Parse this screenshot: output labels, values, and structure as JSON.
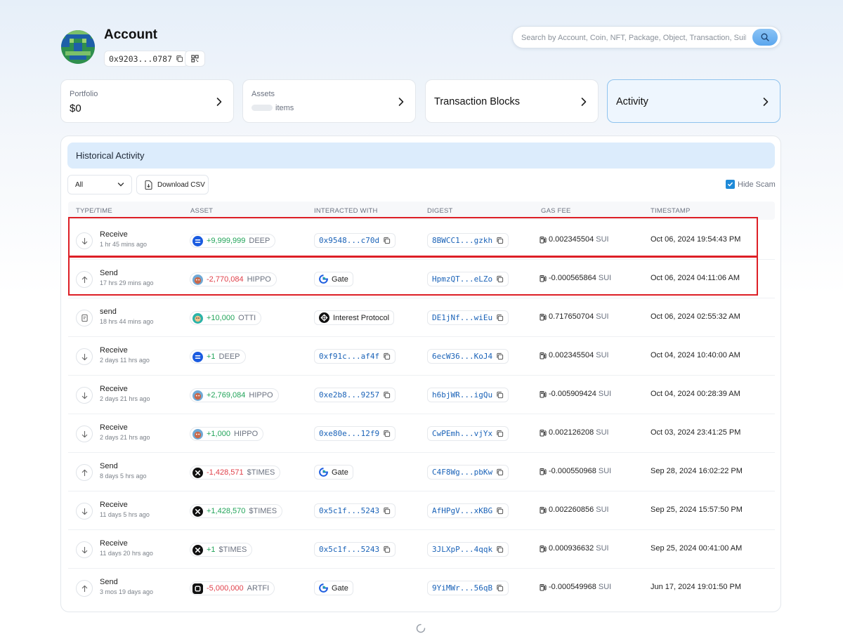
{
  "header": {
    "title": "Account",
    "address": "0x9203...0787"
  },
  "search": {
    "placeholder": "Search by Account, Coin, NFT, Package, Object, Transaction, SuiNS"
  },
  "cards": {
    "portfolio_label": "Portfolio",
    "portfolio_value": "$0",
    "assets_label": "Assets",
    "assets_suffix": "items",
    "tx_blocks_label": "Transaction Blocks",
    "activity_label": "Activity"
  },
  "panel": {
    "title": "Historical Activity",
    "filter_value": "All",
    "download_label": "Download CSV",
    "hide_scam_label": "Hide Scam",
    "hide_scam_checked": true
  },
  "table": {
    "headers": [
      "TYPE/TIME",
      "ASSET",
      "INTERACTED WITH",
      "DIGEST",
      "GAS FEE",
      "TIMESTAMP"
    ],
    "rows": [
      {
        "type": "Receive",
        "age": "1 hr 45 mins ago",
        "dir": "down",
        "amount": "+9,999,999",
        "symbol": "DEEP",
        "coin": "deep",
        "with": "0x9548...c70d",
        "with_kind": "address",
        "digest": "8BWCC1...gzkh",
        "gas": "0.002345504",
        "gas_unit": "SUI",
        "timestamp": "Oct 06, 2024 19:54:43 PM"
      },
      {
        "type": "Send",
        "age": "17 hrs 29 mins ago",
        "dir": "up",
        "amount": "-2,770,084",
        "symbol": "HIPPO",
        "coin": "hippo",
        "with": "Gate",
        "with_kind": "gate",
        "digest": "HpmzQT...eLZo",
        "gas": "-0.000565864",
        "gas_unit": "SUI",
        "timestamp": "Oct 06, 2024 04:11:06 AM"
      },
      {
        "type": "send",
        "age": "18 hrs 44 mins ago",
        "dir": "doc",
        "amount": "+10,000",
        "symbol": "OTTI",
        "coin": "otti",
        "with": "Interest Protocol",
        "with_kind": "interest",
        "digest": "DE1jNf...wiEu",
        "gas": "0.717650704",
        "gas_unit": "SUI",
        "timestamp": "Oct 06, 2024 02:55:32 AM"
      },
      {
        "type": "Receive",
        "age": "2 days 11 hrs ago",
        "dir": "down",
        "amount": "+1",
        "symbol": "DEEP",
        "coin": "deep",
        "with": "0xf91c...af4f",
        "with_kind": "address",
        "digest": "6ecW36...KoJ4",
        "gas": "0.002345504",
        "gas_unit": "SUI",
        "timestamp": "Oct 04, 2024 10:40:00 AM"
      },
      {
        "type": "Receive",
        "age": "2 days 21 hrs ago",
        "dir": "down",
        "amount": "+2,769,084",
        "symbol": "HIPPO",
        "coin": "hippo",
        "with": "0xe2b8...9257",
        "with_kind": "address",
        "digest": "h6bjWR...igQu",
        "gas": "-0.005909424",
        "gas_unit": "SUI",
        "timestamp": "Oct 04, 2024 00:28:39 AM"
      },
      {
        "type": "Receive",
        "age": "2 days 21 hrs ago",
        "dir": "down",
        "amount": "+1,000",
        "symbol": "HIPPO",
        "coin": "hippo",
        "with": "0xe80e...12f9",
        "with_kind": "address",
        "digest": "CwPEmh...vjYx",
        "gas": "0.002126208",
        "gas_unit": "SUI",
        "timestamp": "Oct 03, 2024 23:41:25 PM"
      },
      {
        "type": "Send",
        "age": "8 days 5 hrs ago",
        "dir": "up",
        "amount": "-1,428,571",
        "symbol": "$TIMES",
        "coin": "times",
        "with": "Gate",
        "with_kind": "gate",
        "digest": "C4F8Wg...pbKw",
        "gas": "-0.000550968",
        "gas_unit": "SUI",
        "timestamp": "Sep 28, 2024 16:02:22 PM"
      },
      {
        "type": "Receive",
        "age": "11 days 5 hrs ago",
        "dir": "down",
        "amount": "+1,428,570",
        "symbol": "$TIMES",
        "coin": "times",
        "with": "0x5c1f...5243",
        "with_kind": "address",
        "digest": "AfHPgV...xKBG",
        "gas": "0.002260856",
        "gas_unit": "SUI",
        "timestamp": "Sep 25, 2024 15:57:50 PM"
      },
      {
        "type": "Receive",
        "age": "11 days 20 hrs ago",
        "dir": "down",
        "amount": "+1",
        "symbol": "$TIMES",
        "coin": "times",
        "with": "0x5c1f...5243",
        "with_kind": "address",
        "digest": "3JLXpP...4qqk",
        "gas": "0.000936632",
        "gas_unit": "SUI",
        "timestamp": "Sep 25, 2024 00:41:00 AM"
      },
      {
        "type": "Send",
        "age": "3 mos 19 days ago",
        "dir": "up",
        "amount": "-5,000,000",
        "symbol": "ARTFI",
        "coin": "artfi",
        "with": "Gate",
        "with_kind": "gate",
        "digest": "9YiMWr...56qB",
        "gas": "-0.000549968",
        "gas_unit": "SUI",
        "timestamp": "Jun 17, 2024 19:01:50 PM"
      }
    ]
  },
  "colors": {
    "accent": "#1f8ad8",
    "positive": "#22a45a",
    "negative": "#e0414b",
    "highlight_box": "#dd1f26"
  }
}
